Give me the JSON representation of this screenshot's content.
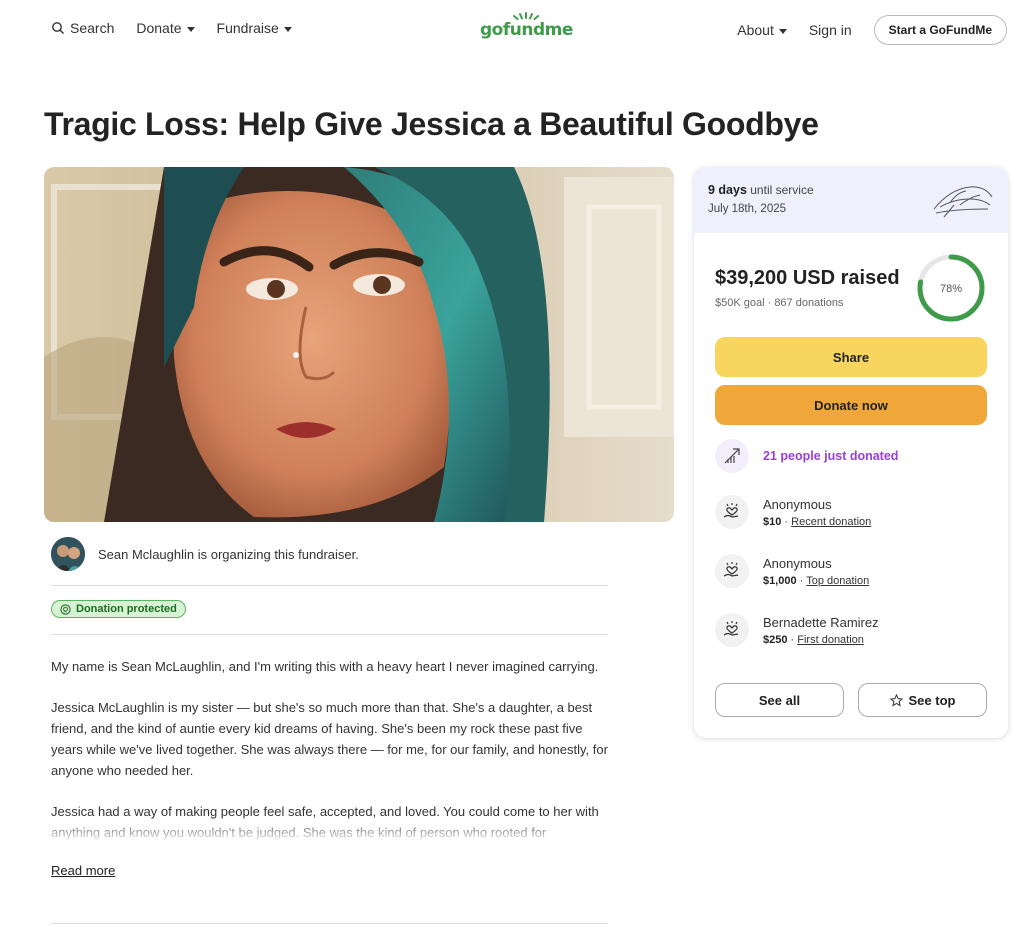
{
  "nav": {
    "search": "Search",
    "donate": "Donate",
    "fundraise": "Fundraise",
    "logo": "gofundme",
    "about": "About",
    "signin": "Sign in",
    "start": "Start a GoFundMe"
  },
  "page": {
    "title": "Tragic Loss: Help Give Jessica a Beautiful Goodbye"
  },
  "organizer": {
    "text": "Sean Mclaughlin is organizing this fundraiser."
  },
  "badge": "Donation protected",
  "story": {
    "paragraphs": [
      "My name is Sean McLaughlin, and I'm writing this with a heavy heart I never imagined carrying.",
      "Jessica McLaughlin is my sister — but she's so much more than that. She's a daughter, a best friend, and the kind of auntie every kid dreams of having. She's been my rock these past five years while we've lived together. She was always there — for me, for our family, and honestly, for anyone who needed her.",
      "Jessica had a way of making people feel safe, accepted, and loved. You could come to her with anything and know you wouldn't be judged. She was the kind of person who rooted for"
    ],
    "read_more": "Read more"
  },
  "card": {
    "days_bold": "9 days",
    "days_rest": " until service",
    "date": "July 18th, 2025",
    "raised": "$39,200 USD raised",
    "goal": "$50K goal  ·  867 donations",
    "percent": "78%",
    "progress": 0.78,
    "share": "Share",
    "donate": "Donate now",
    "recent": "21 people just donated",
    "donors": [
      {
        "name": "Anonymous",
        "amount": "$10",
        "label": "Recent donation"
      },
      {
        "name": "Anonymous",
        "amount": "$1,000",
        "label": "Top donation"
      },
      {
        "name": "Bernadette Ramirez",
        "amount": "$250",
        "label": "First donation"
      }
    ],
    "see_all": "See all",
    "see_top": "See top"
  },
  "colors": {
    "brand": "#3f9b4a",
    "share": "#f7d55f",
    "donate": "#f0a73a",
    "recent": "#9b3fd8",
    "badge_bg": "#d6f3d3"
  }
}
